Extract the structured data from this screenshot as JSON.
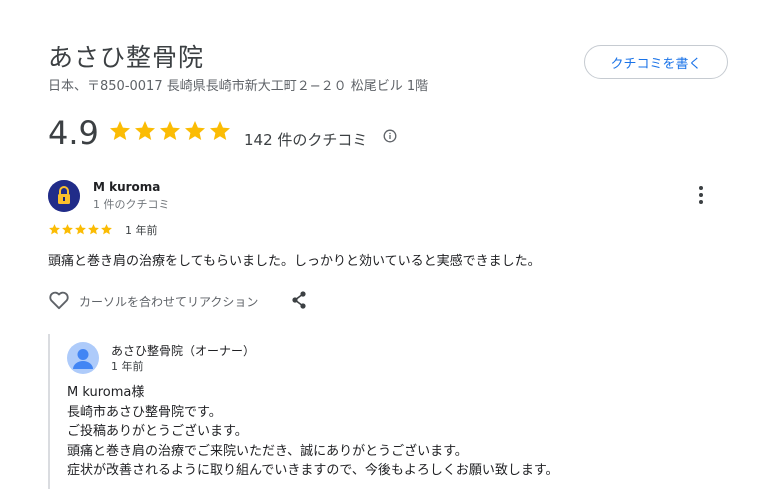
{
  "place": {
    "name": "あさひ整骨院",
    "address": "日本、〒850-0017 長崎県長崎市新大工町２−２０ 松尾ビル 1階",
    "write_review_label": "クチコミを書く"
  },
  "summary": {
    "rating": "4.9",
    "stars": 5,
    "review_count_label": "142 件のクチコミ"
  },
  "review": {
    "author": "M kuroma",
    "author_reviews": "1 件のクチコミ",
    "stars": 5,
    "age": "1 年前",
    "text": "頭痛と巻き肩の治療をしてもらいました。しっかりと効いていると実感できました。",
    "react_label": "カーソルを合わせてリアクション"
  },
  "owner_reply": {
    "name": "あさひ整骨院（オーナー）",
    "age": "1 年前",
    "lines": [
      "M kuroma様",
      "長崎市あさひ整骨院です。",
      "ご投稿ありがとうございます。",
      "頭痛と巻き肩の治療でご来院いただき、誠にありがとうございます。",
      "症状が改善されるように取り組んでいきますので、今後もよろしくお願い致します。"
    ]
  },
  "colors": {
    "star": "#fbbc04",
    "link": "#1a73e8",
    "avatar_bg": "#1a237e",
    "owner_avatar_bg": "#aecbfa",
    "owner_avatar_fg": "#4285f4"
  },
  "icons": {
    "rating_star": "star-icon",
    "info": "info-icon",
    "more": "more-vert-icon",
    "heart": "heart-outline-icon",
    "share": "share-icon",
    "owner_avatar": "person-icon"
  }
}
